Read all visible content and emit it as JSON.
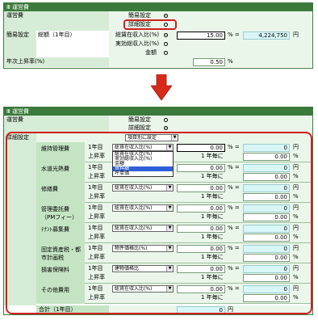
{
  "top": {
    "title": "Ⅲ 運営費",
    "row_label": "運営費",
    "radio_simple": "簡易設定",
    "radio_detail": "詳細設定",
    "simple_label": "簡易設定",
    "total_label": "総額（1年目）",
    "opt1": "総賃在収入比(%)",
    "opt2": "実効総収入比(%)",
    "opt3": "金額",
    "pct_value": "15.00",
    "pct_unit": "% =",
    "amount_value": "4,224,750",
    "amount_unit": "円",
    "rate_label": "年次上昇率(%)",
    "rate_value": "0.50",
    "rate_unit": "%"
  },
  "bottom": {
    "title": "Ⅲ 運営費",
    "row_label": "運営費",
    "radio_simple": "簡易設定",
    "radio_detail": "詳細設定",
    "detail_label": "詳細設定",
    "method_select": "項目別に設定",
    "year1": "1年目",
    "rise": "上昇率",
    "pct_unit": "% =",
    "yen": "円",
    "per_year": "1 年毎に",
    "pct": "%",
    "items": [
      {
        "name": "維持管理費",
        "select": "総賃在収入比(%)",
        "pct": "0.00",
        "yen": "0",
        "rate": "0.00"
      },
      {
        "name": "水道光熱費",
        "select": "総賃在収入比(%)",
        "pct": "0.00",
        "yen": "0",
        "rate": "0.00"
      },
      {
        "name": "修繕費",
        "select": "総賃在収入比(%)",
        "pct": "0.00",
        "yen": "0",
        "rate": "0.00"
      },
      {
        "name": "管理委託費（PMフィー）",
        "select": "総賃在収入比(%)",
        "pct": "0.00",
        "yen": "0",
        "rate": "0.00"
      },
      {
        "name": "ﾃﾅﾝﾄ募集費",
        "select": "総賃在収入比(%)",
        "pct": "0.00",
        "yen": "0",
        "rate": "0.00"
      },
      {
        "name": "固定資産税・都市計画税",
        "select": "物件価格比(%)",
        "pct": "0.00",
        "yen": "0",
        "rate": "0.00"
      },
      {
        "name": "損害保険料",
        "select": "建物価格比",
        "pct": "0.00",
        "yen": "0",
        "rate": "0.00"
      },
      {
        "name": "その他費用",
        "select": "総賃在収入比(%)",
        "pct": "0.00",
        "yen": "0",
        "rate": "0.00"
      }
    ],
    "dropdown_options": [
      "総賃在収入比(%)",
      "実効総収入比(%)",
      "金額",
      "賃料額",
      "坪単価"
    ],
    "total_label": "合計（1年目）",
    "total_value": "0",
    "total_unit": "円"
  },
  "colors": {
    "header": "#3a7a3a",
    "label_bg": "#d6ecd6",
    "highlight": "#d02020",
    "arrow": "#d62a1a",
    "cyan": "#d9f6f6"
  }
}
